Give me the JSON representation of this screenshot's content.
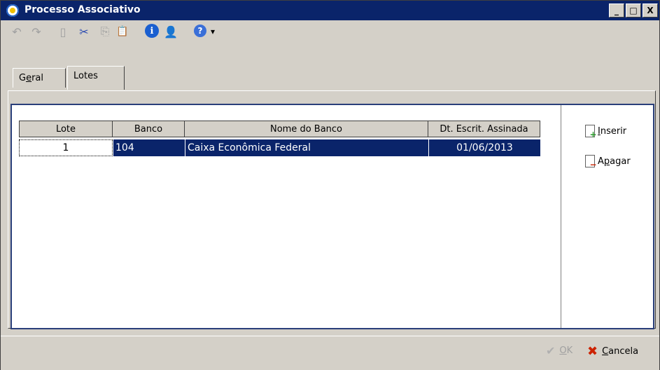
{
  "window": {
    "title": "Processo Associativo",
    "controls": [
      "_",
      "□",
      "X"
    ]
  },
  "toolbar": {
    "items": [
      {
        "name": "undo-icon",
        "glyph": "↶",
        "enabled": false
      },
      {
        "name": "redo-icon",
        "glyph": "↷",
        "enabled": false
      },
      {
        "name": "new-document-icon",
        "glyph": "▯",
        "enabled": false
      },
      {
        "name": "cut-icon",
        "glyph": "✂",
        "enabled": true
      },
      {
        "name": "copy-icon",
        "glyph": "⎘",
        "enabled": false
      },
      {
        "name": "paste-icon",
        "glyph": "📋",
        "enabled": true
      },
      {
        "name": "info-icon",
        "glyph": "ℹ",
        "enabled": true
      },
      {
        "name": "user-icon",
        "glyph": "👤",
        "enabled": true
      },
      {
        "name": "help-icon",
        "glyph": "?",
        "enabled": true
      },
      {
        "name": "dropdown-arrow-icon",
        "glyph": "▾",
        "enabled": true
      }
    ]
  },
  "tabs": [
    {
      "label_pre": "G",
      "label_u": "e",
      "label_post": "ral",
      "active": false
    },
    {
      "label": "Lotes",
      "active": true
    }
  ],
  "grid": {
    "columns": [
      "Lote",
      "Banco",
      "Nome do Banco",
      "Dt. Escrit. Assinada"
    ],
    "rows": [
      {
        "lote": "1",
        "banco": "104",
        "nome": "Caixa Econômica Federal",
        "data": "01/06/2013"
      }
    ]
  },
  "side_buttons": {
    "inserir": {
      "underline": "I",
      "rest": "nserir"
    },
    "apagar": {
      "pre": "A",
      "underline": "p",
      "rest": "agar"
    }
  },
  "footer": {
    "ok": {
      "underline": "O",
      "rest": "K"
    },
    "cancela": {
      "underline": "C",
      "rest": "ancela"
    }
  },
  "colors": {
    "titlebar": "#0a246a",
    "selection": "#0a246a",
    "background": "#d4d0c8",
    "cancel_red": "#cc2200",
    "ok_disabled": "#a0a0a0"
  }
}
